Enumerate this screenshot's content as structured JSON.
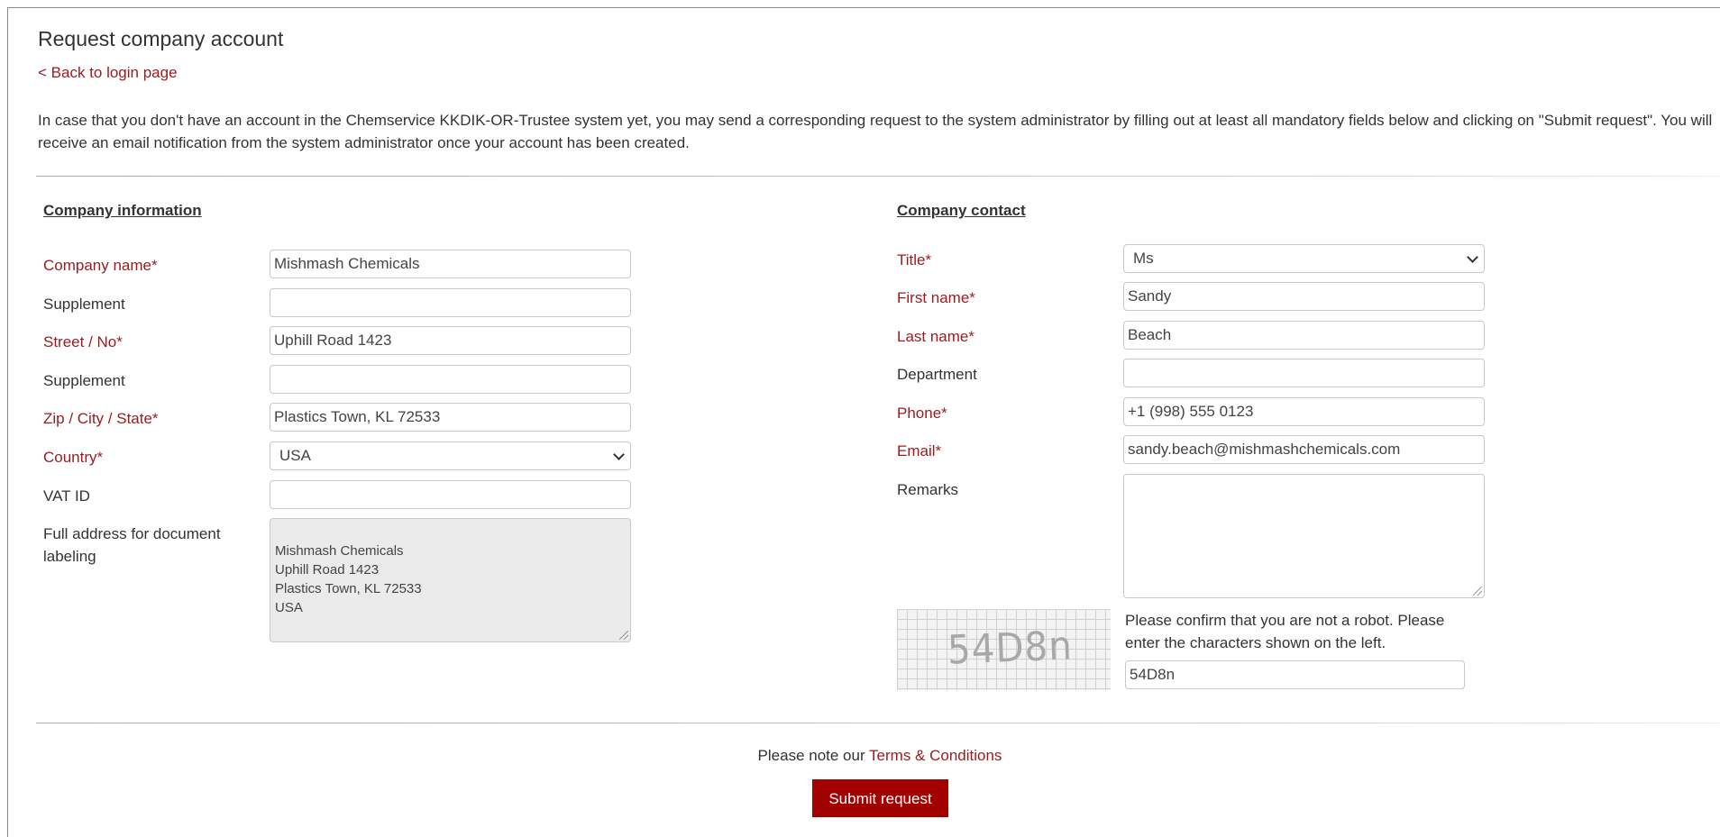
{
  "page": {
    "title": "Request company account",
    "back_link": "< Back to login page",
    "intro": "In case that you don't have an account in the Chemservice KKDIK-OR-Trustee system yet, you may send a corresponding request to the system administrator by filling out at least all mandatory fields below and clicking on \"Submit request\". You will receive an email notification from the system administrator once your account has been created."
  },
  "company_info": {
    "heading": "Company information",
    "company_name": {
      "label": "Company name*",
      "value": "Mishmash Chemicals"
    },
    "supplement1": {
      "label": "Supplement",
      "value": ""
    },
    "street": {
      "label": "Street / No*",
      "value": "Uphill Road 1423"
    },
    "supplement2": {
      "label": "Supplement",
      "value": ""
    },
    "zip_city_state": {
      "label": "Zip / City / State*",
      "value": "Plastics Town, KL 72533"
    },
    "country": {
      "label": "Country*",
      "value": "USA"
    },
    "vat_id": {
      "label": "VAT ID",
      "value": ""
    },
    "full_address": {
      "label": "Full address for document labeling",
      "value": "Mishmash Chemicals\nUphill Road 1423\nPlastics Town, KL 72533\nUSA"
    }
  },
  "company_contact": {
    "heading": "Company contact",
    "title": {
      "label": "Title*",
      "value": "Ms"
    },
    "first_name": {
      "label": "First name*",
      "value": "Sandy"
    },
    "last_name": {
      "label": "Last name*",
      "value": "Beach"
    },
    "department": {
      "label": "Department",
      "value": ""
    },
    "phone": {
      "label": "Phone*",
      "value": "+1 (998) 555 0123"
    },
    "email": {
      "label": "Email*",
      "value": "sandy.beach@mishmashchemicals.com"
    },
    "remarks": {
      "label": "Remarks",
      "value": ""
    }
  },
  "captcha": {
    "image_text": "54D8n",
    "hint": "Please confirm that you are not a robot. Please enter the characters shown on the left.",
    "value": "54D8n"
  },
  "footer": {
    "note_prefix": "Please note our ",
    "terms_link": "Terms & Conditions",
    "submit_label": "Submit request"
  },
  "colors": {
    "accent": "#9b1b1e",
    "button": "#a30000",
    "readonly_bg": "#ebebeb"
  }
}
